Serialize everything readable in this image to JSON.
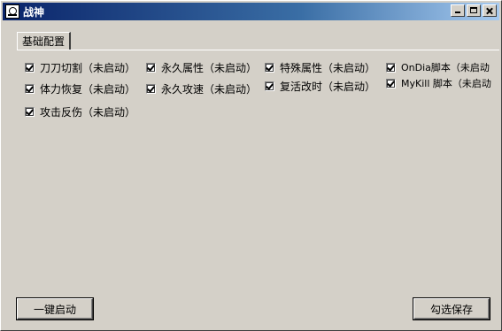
{
  "window": {
    "title": "战神"
  },
  "tabs": [
    {
      "label": "基础配置"
    }
  ],
  "options": {
    "col1": [
      {
        "label": "刀刀切割（未启动）",
        "checked": true
      },
      {
        "label": "体力恢复（未启动）",
        "checked": true
      },
      {
        "label": "攻击反伤（未启动）",
        "checked": true
      }
    ],
    "col2": [
      {
        "label": "永久属性（未启动）",
        "checked": true
      },
      {
        "label": "永久攻速（未启动）",
        "checked": true
      }
    ],
    "col3": [
      {
        "label": "特殊属性（未启动）",
        "checked": true
      },
      {
        "label": "复活改时（未启动）",
        "checked": true
      }
    ],
    "col4": [
      {
        "label": "OnDia脚本（未启动",
        "checked": true
      },
      {
        "label": "MyKill 脚本（未启动",
        "checked": true
      }
    ]
  },
  "buttons": {
    "start_all": "一键启动",
    "save_selection": "勾选保存"
  },
  "colors": {
    "face": "#d4d0c8",
    "title_start": "#0a246a",
    "title_end": "#a6caf0"
  }
}
